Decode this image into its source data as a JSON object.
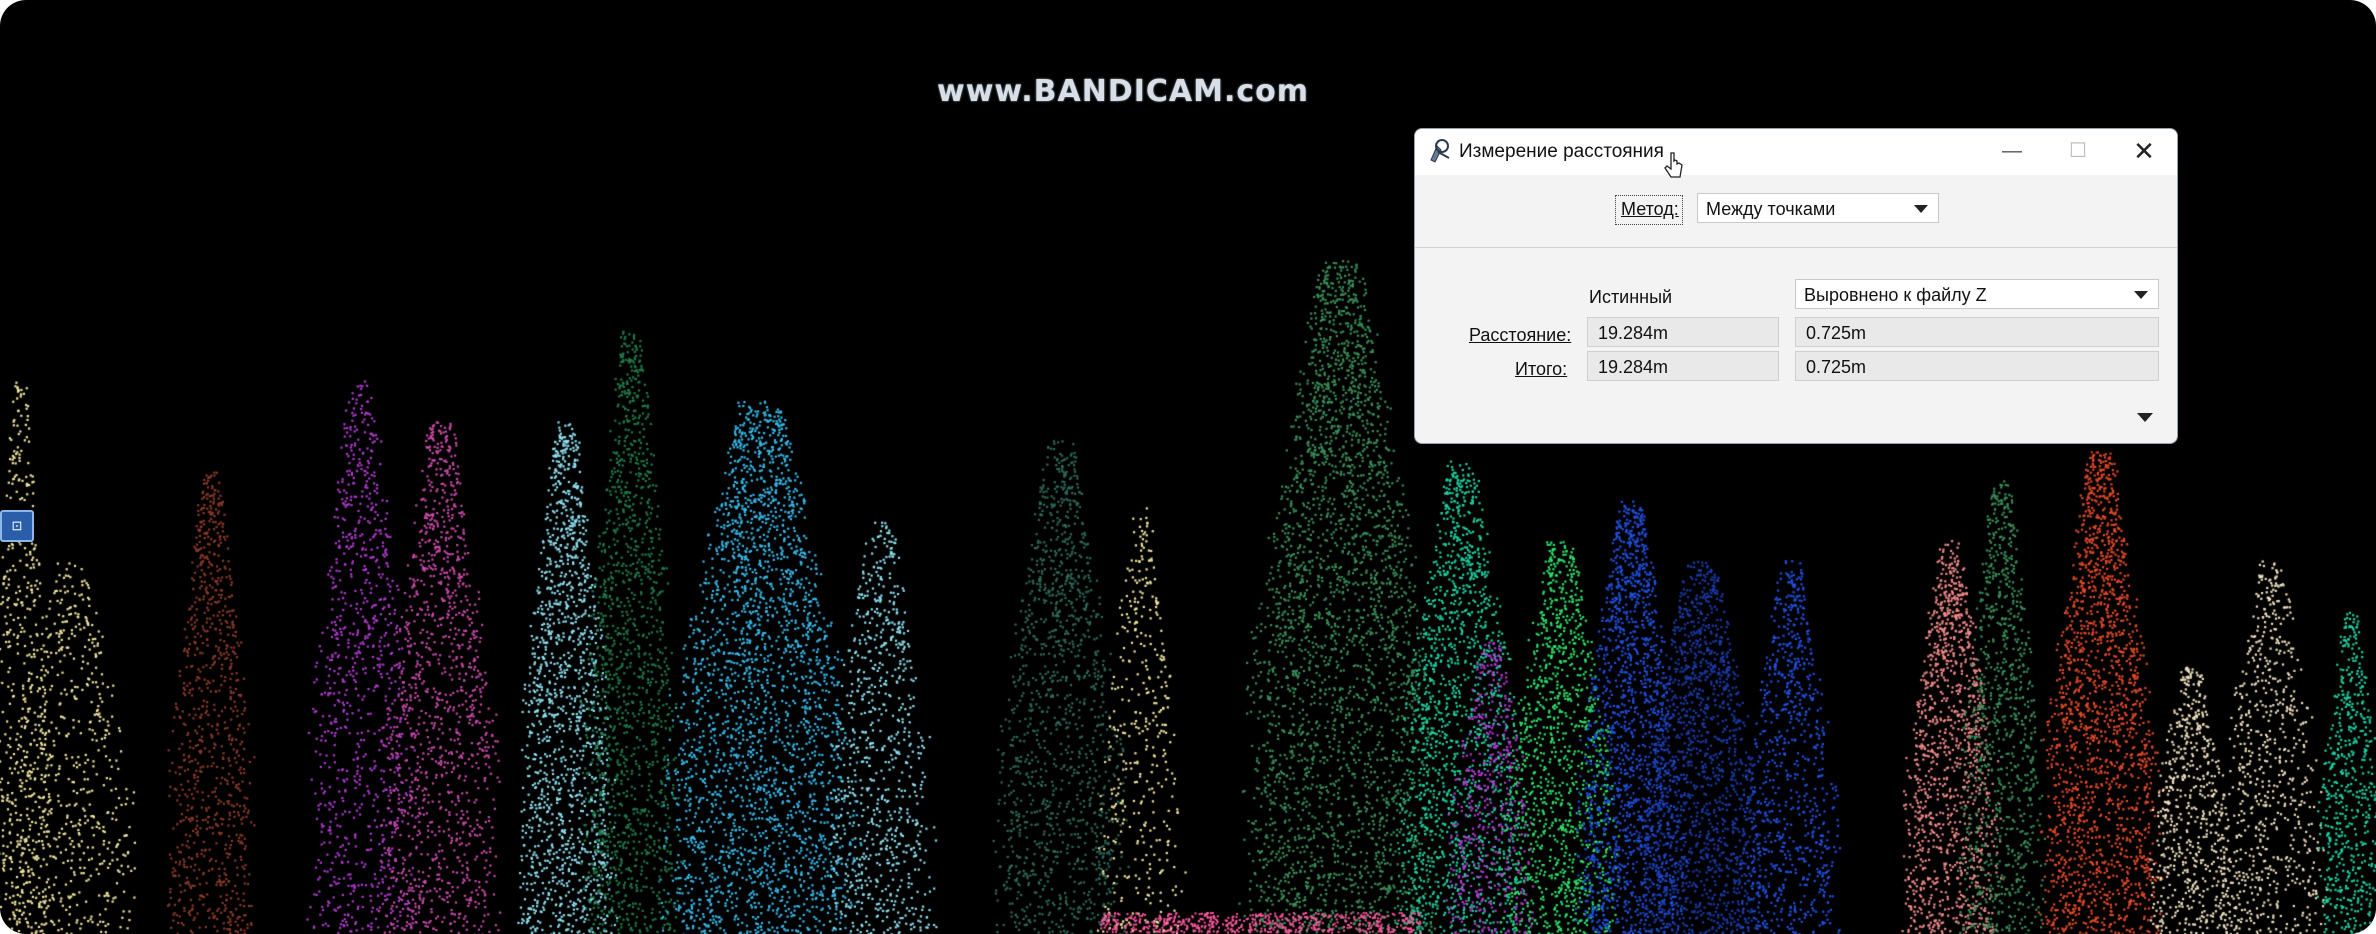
{
  "watermark": "www.BANDICAM.com",
  "dialog": {
    "title": "Измерение расстояния",
    "method_label": "Метод:",
    "method_value": "Между точками",
    "true_header": "Истинный",
    "projection_value": "Выровнено к файлу Z",
    "distance_label": "Расстояние:",
    "total_label": "Итого:",
    "distance_true": "19.284m",
    "distance_projected": "0.725m",
    "total_true": "19.284m",
    "total_projected": "0.725m",
    "icons": {
      "app": "measure-distance-icon",
      "minimize": "minimize-icon",
      "maximize": "maximize-icon",
      "close": "close-icon",
      "expand": "chevron-down-icon",
      "cursor": "mouse-cursor-icon"
    }
  },
  "view_marker": "view-cube-icon",
  "colors": {
    "background": "#000000",
    "tree_palette": [
      "#f2e6a0",
      "#8a3a2a",
      "#b03ad0",
      "#c84aa8",
      "#8fe0f0",
      "#1f7a4a",
      "#38b8e8",
      "#2e6a5a",
      "#3a8f5a",
      "#1fd0a0",
      "#2fe06a",
      "#2050e0",
      "#1a3aa8",
      "#f08a8a",
      "#e04a28",
      "#f0e0c0",
      "#ff5aa0"
    ]
  }
}
